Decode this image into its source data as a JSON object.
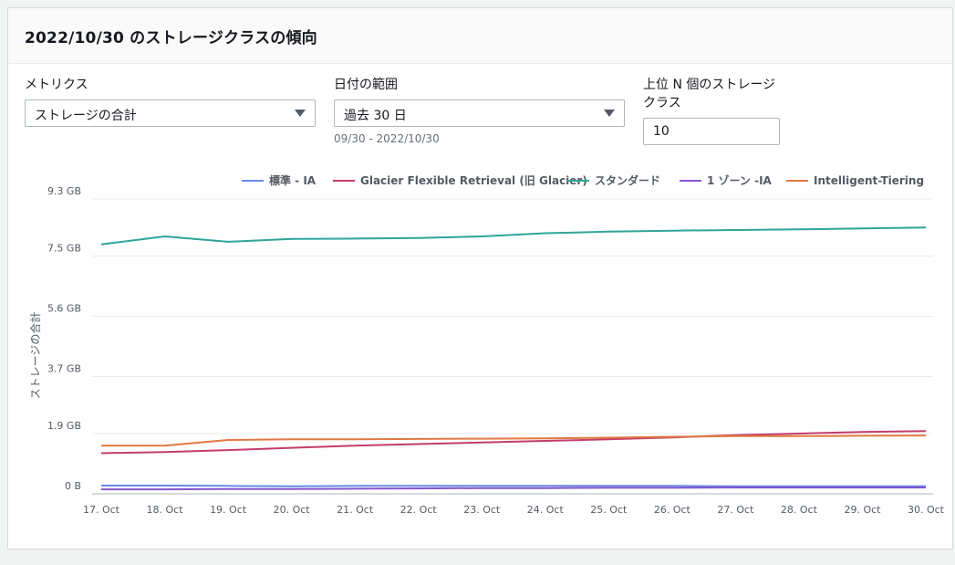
{
  "header": {
    "title": "2022/10/30 のストレージクラスの傾向"
  },
  "filters": {
    "metrics": {
      "label": "メトリクス",
      "value": "ストレージの合計"
    },
    "date_range": {
      "label": "日付の範囲",
      "value": "過去 30 日",
      "hint": "09/30 - 2022/10/30"
    },
    "top_n": {
      "label": "上位 N 個のストレージクラス",
      "value": "10"
    }
  },
  "chart_data": {
    "type": "line",
    "ylabel": "ストレージの合計",
    "xlabel": "",
    "x": [
      "17. Oct",
      "18. Oct",
      "19. Oct",
      "20. Oct",
      "21. Oct",
      "22. Oct",
      "23. Oct",
      "24. Oct",
      "25. Oct",
      "26. Oct",
      "27. Oct",
      "28. Oct",
      "29. Oct",
      "30. Oct"
    ],
    "yticks": [
      0,
      1.9,
      3.7,
      5.6,
      7.5,
      9.3
    ],
    "ytick_labels": [
      "0 B",
      "1.9 GB",
      "3.7 GB",
      "5.6 GB",
      "7.5 GB",
      "9.3 GB"
    ],
    "ylim": [
      0,
      9.3
    ],
    "grid": true,
    "legend_position": "top",
    "series": [
      {
        "name": "標準 - IA",
        "color": "#688ae8",
        "values": [
          0.26,
          0.26,
          0.25,
          0.24,
          0.25,
          0.25,
          0.25,
          0.25,
          0.25,
          0.25,
          0.24,
          0.24,
          0.24,
          0.24
        ]
      },
      {
        "name": "Glacier Flexible Retrieval (旧 Glacier)",
        "color": "#c33d69",
        "values": [
          1.28,
          1.32,
          1.38,
          1.45,
          1.52,
          1.57,
          1.62,
          1.67,
          1.72,
          1.78,
          1.85,
          1.9,
          1.95,
          1.98
        ]
      },
      {
        "name": "スタンダード",
        "color": "#2ea597",
        "values": [
          7.87,
          8.12,
          7.95,
          8.04,
          8.05,
          8.07,
          8.12,
          8.22,
          8.27,
          8.3,
          8.32,
          8.34,
          8.37,
          8.4
        ]
      },
      {
        "name": "1 ゾーン -IA",
        "color": "#8456ce",
        "values": [
          0.14,
          0.14,
          0.15,
          0.15,
          0.16,
          0.17,
          0.18,
          0.18,
          0.19,
          0.19,
          0.2,
          0.2,
          0.2,
          0.2
        ]
      },
      {
        "name": "Intelligent-Tiering",
        "color": "#e07941",
        "values": [
          1.52,
          1.52,
          1.7,
          1.72,
          1.72,
          1.73,
          1.74,
          1.75,
          1.77,
          1.8,
          1.82,
          1.82,
          1.83,
          1.84
        ]
      }
    ]
  }
}
